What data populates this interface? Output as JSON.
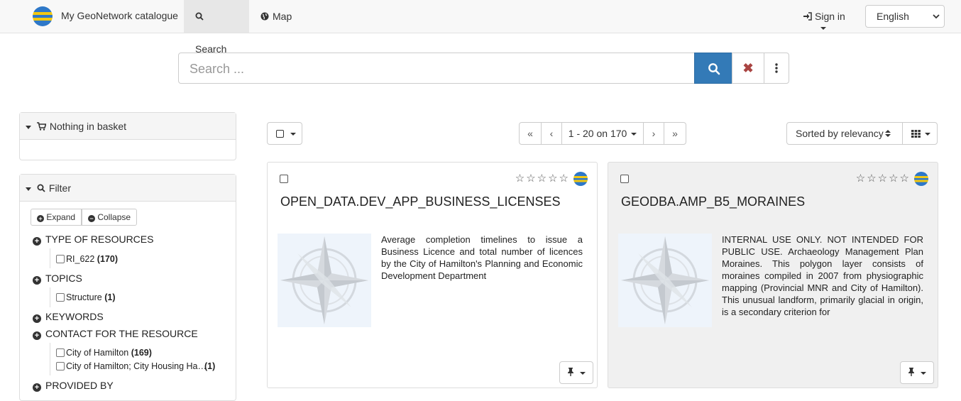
{
  "header": {
    "brand": "My GeoNetwork catalogue",
    "tabs": [
      {
        "label": "Search",
        "icon": "search-icon",
        "active": true
      },
      {
        "label": "Map",
        "icon": "globe-icon",
        "active": false
      }
    ],
    "signin_label": "Sign in",
    "language": "English"
  },
  "search": {
    "placeholder": "Search ..."
  },
  "basket": {
    "label": "Nothing in basket"
  },
  "filter": {
    "title": "Filter",
    "expand_label": "Expand",
    "collapse_label": "Collapse",
    "facets": [
      {
        "label": "TYPE OF RESOURCES",
        "items": [
          {
            "label": "RI_622",
            "count": "(170)"
          }
        ]
      },
      {
        "label": "TOPICS",
        "items": [
          {
            "label": "Structure",
            "count": "(1)"
          }
        ]
      },
      {
        "label": "KEYWORDS",
        "items": []
      },
      {
        "label": "CONTACT FOR THE RESOURCE",
        "items": [
          {
            "label": "City of Hamilton",
            "count": "(169)"
          },
          {
            "label": "City of Hamilton; City Housing Ha…",
            "count": "(1)"
          }
        ]
      },
      {
        "label": "PROVIDED BY",
        "items": []
      }
    ]
  },
  "results": {
    "pager": {
      "first": "«",
      "prev": "‹",
      "range": "1 - 20 on 170",
      "next": "›",
      "last": "»"
    },
    "sort_label": "Sorted by relevancy",
    "records": [
      {
        "title": "OPEN_DATA.DEV_APP_BUSINESS_LICENSES",
        "description": "Average completion timelines to issue a Business Licence and total number of licences by the City of Hamilton's Planning and Economic Development Department",
        "rating": "☆☆☆☆☆"
      },
      {
        "title": "GEODBA.AMP_B5_MORAINES",
        "description": "INTERNAL USE ONLY. NOT INTENDED FOR PUBLIC USE. Archaeology Management Plan Moraines. This polygon layer consists of moraines compiled in 2007 from physiographic mapping (Provincial MNR and City of Hamilton). This unusual landform, primarily glacial in origin, is a secondary criterion for",
        "rating": "☆☆☆☆☆"
      }
    ]
  },
  "colors": {
    "primary": "#337ab7",
    "danger": "#a94442",
    "navbar_bg": "#f8f8f8"
  }
}
